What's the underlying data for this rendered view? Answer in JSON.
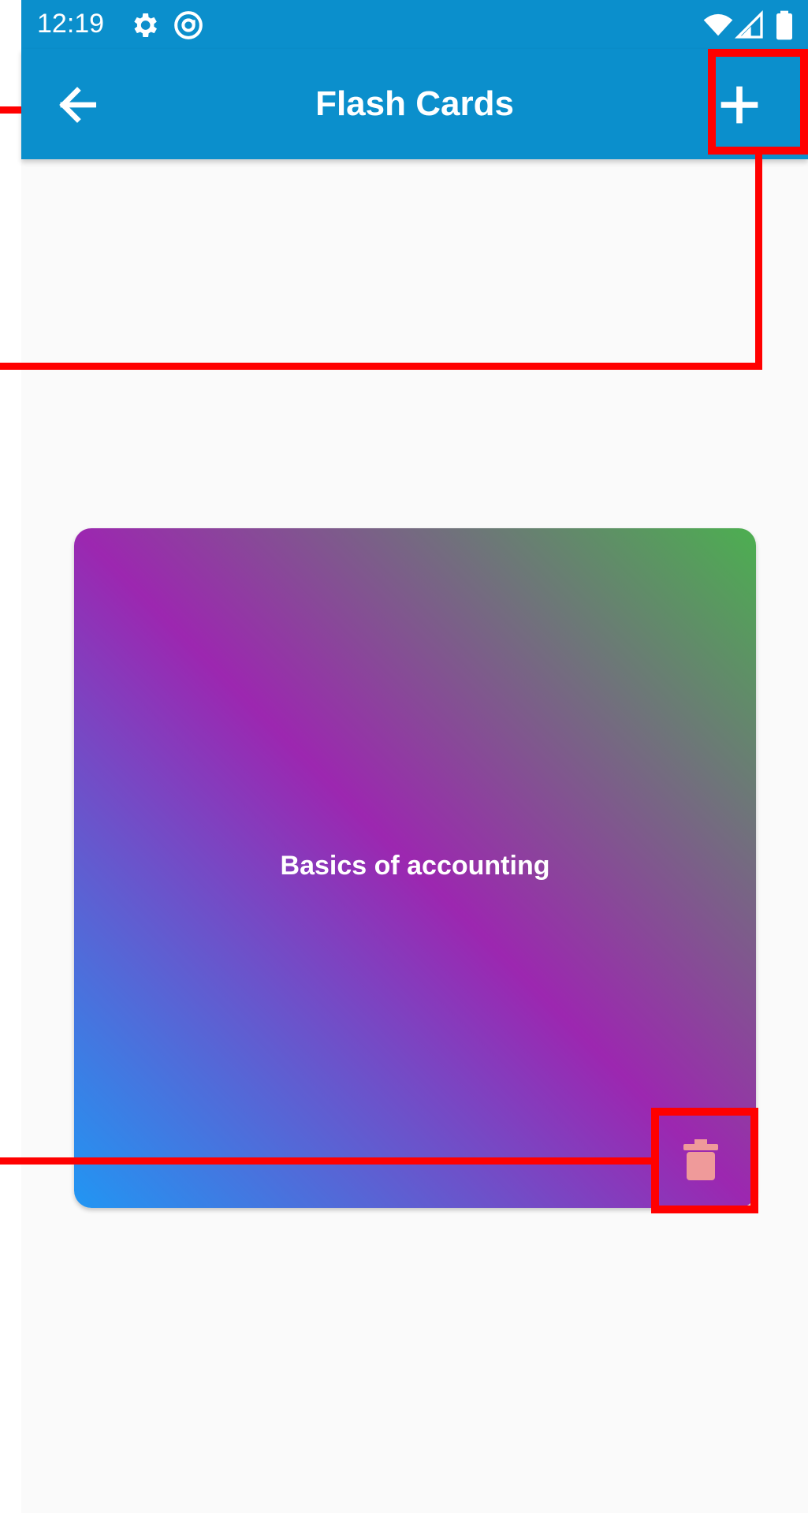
{
  "status_bar": {
    "time": "12:19",
    "icons": [
      "settings-icon",
      "at-sign-icon",
      "wifi-icon",
      "signal-icon",
      "battery-icon"
    ]
  },
  "app_bar": {
    "title": "Flash Cards",
    "back_icon": "arrow-back-icon",
    "add_icon": "plus-icon"
  },
  "cards": [
    {
      "title": "Basics of accounting",
      "gradient": [
        "#2196f3",
        "#9c27b0",
        "#4caf50"
      ],
      "delete_icon": "trash-icon"
    }
  ],
  "colors": {
    "app_bar": "#0b8fcc",
    "background": "#fafafa",
    "delete_icon": "#ef9a9a",
    "annotation": "#ff0000"
  }
}
